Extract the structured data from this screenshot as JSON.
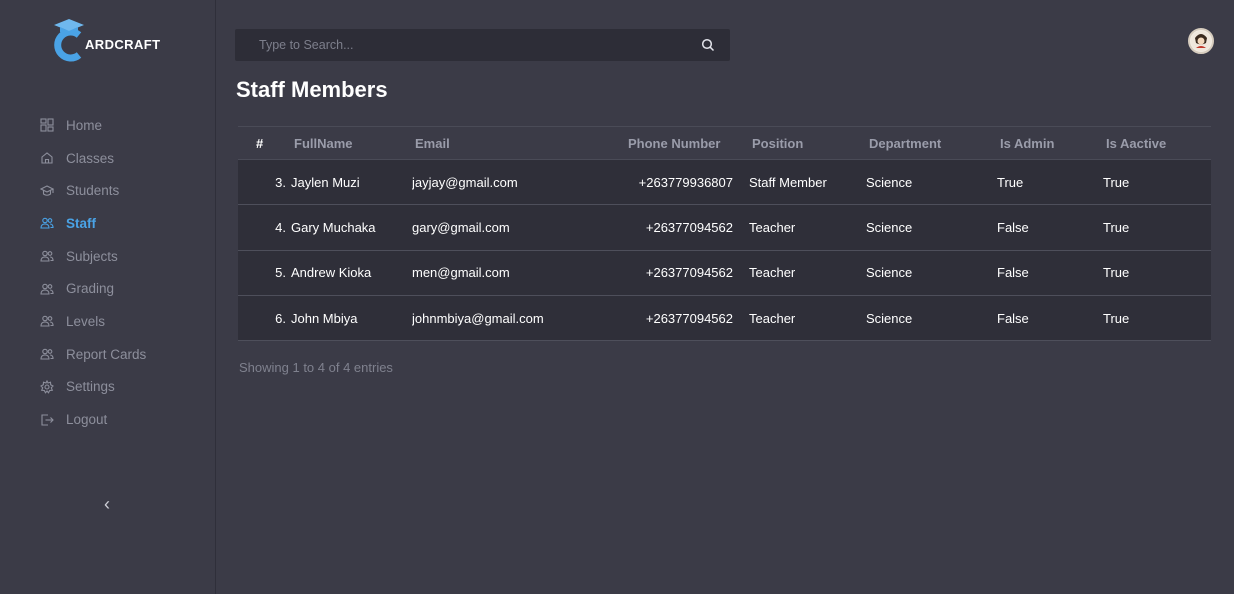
{
  "app": {
    "logo_text": "ARDCRAFT",
    "accent_color": "#4aa3e6"
  },
  "sidebar": {
    "items": [
      {
        "label": "Home",
        "icon": "grid-icon",
        "active": false
      },
      {
        "label": "Classes",
        "icon": "home-icon",
        "active": false
      },
      {
        "label": "Students",
        "icon": "graduation-cap-icon",
        "active": false
      },
      {
        "label": "Staff",
        "icon": "users-icon",
        "active": true
      },
      {
        "label": "Subjects",
        "icon": "users-icon",
        "active": false
      },
      {
        "label": "Grading",
        "icon": "users-icon",
        "active": false
      },
      {
        "label": "Levels",
        "icon": "users-icon",
        "active": false
      },
      {
        "label": "Report Cards",
        "icon": "users-icon",
        "active": false
      },
      {
        "label": "Settings",
        "icon": "gear-icon",
        "active": false
      },
      {
        "label": "Logout",
        "icon": "logout-icon",
        "active": false
      }
    ],
    "collapse_glyph": "‹"
  },
  "search": {
    "placeholder": "Type to Search..."
  },
  "page": {
    "title": "Staff Members"
  },
  "table": {
    "columns": [
      "#",
      "FullName",
      "Email",
      "Phone Number",
      "Position",
      "Department",
      "Is Admin",
      "Is Aactive"
    ],
    "rows": [
      {
        "num": "3.",
        "name": "Jaylen Muzi",
        "email": "jayjay@gmail.com",
        "phone": "+263779936807",
        "position": "Staff Member",
        "department": "Science",
        "is_admin": "True",
        "is_active": "True"
      },
      {
        "num": "4.",
        "name": "Gary Muchaka",
        "email": "gary@gmail.com",
        "phone": "+26377094562",
        "position": "Teacher",
        "department": "Science",
        "is_admin": "False",
        "is_active": "True"
      },
      {
        "num": "5.",
        "name": "Andrew Kioka",
        "email": "men@gmail.com",
        "phone": "+26377094562",
        "position": "Teacher",
        "department": "Science",
        "is_admin": "False",
        "is_active": "True"
      },
      {
        "num": "6.",
        "name": "John Mbiya",
        "email": "johnmbiya@gmail.com",
        "phone": "+26377094562",
        "position": "Teacher",
        "department": "Science",
        "is_admin": "False",
        "is_active": "True"
      }
    ],
    "info": "Showing 1 to 4 of 4 entries"
  }
}
